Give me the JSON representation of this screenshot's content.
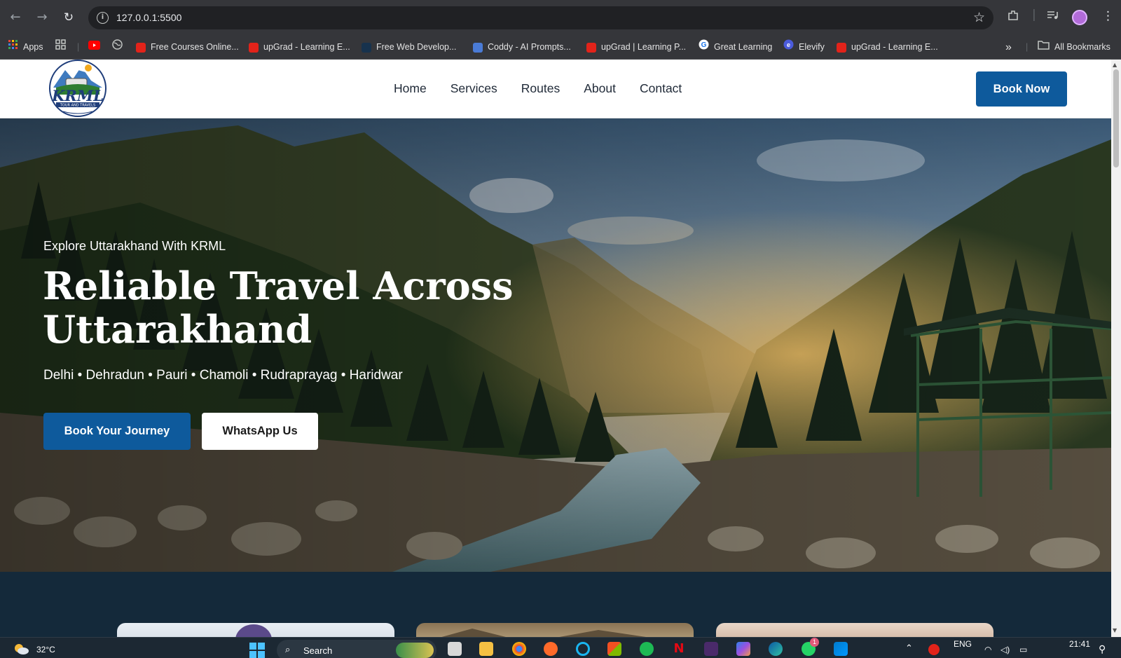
{
  "browser": {
    "url": "127.0.0.1:5500",
    "bookmarks": [
      {
        "label": "Apps"
      },
      {
        "label": ""
      },
      {
        "label": ""
      },
      {
        "label": ""
      },
      {
        "label": "Free Courses Online..."
      },
      {
        "label": "upGrad - Learning E..."
      },
      {
        "label": "Free Web Develop..."
      },
      {
        "label": "Coddy - AI Prompts..."
      },
      {
        "label": "upGrad | Learning P..."
      },
      {
        "label": "Great Learning"
      },
      {
        "label": "Elevify"
      },
      {
        "label": "upGrad - Learning E..."
      }
    ],
    "all_bookmarks": "All Bookmarks",
    "overflow": "»"
  },
  "site": {
    "brand": "KRML",
    "brand_sub": "TOUR AND TRAVELS",
    "nav": [
      {
        "label": "Home"
      },
      {
        "label": "Services"
      },
      {
        "label": "Routes"
      },
      {
        "label": "About"
      },
      {
        "label": "Contact"
      }
    ],
    "book_now": "Book Now"
  },
  "hero": {
    "eyebrow": "Explore Uttarakhand With KRML",
    "title_line1": "Reliable Travel Across",
    "title_line2": "Uttarakhand",
    "subtitle": "Delhi • Dehradun • Pauri • Chamoli • Rudraprayag • Haridwar",
    "primary_cta": "Book Your Journey",
    "secondary_cta": "WhatsApp Us"
  },
  "taskbar": {
    "weather": "32°C",
    "search_placeholder": "Search",
    "language": "ENG",
    "time": "21:41",
    "whatsapp_badge": "1"
  },
  "colors": {
    "primary": "#0e5a9c",
    "section_bg": "#14293a"
  }
}
